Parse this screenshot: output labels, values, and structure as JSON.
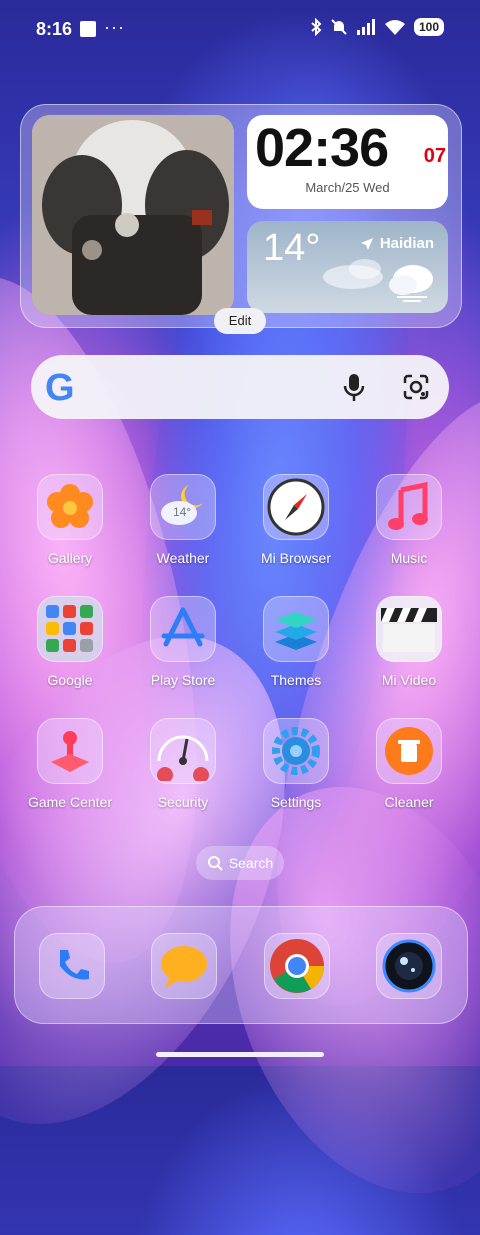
{
  "status_bar": {
    "time": "8:16",
    "dots": "···",
    "battery": "100"
  },
  "widget": {
    "clock_time": "02:36",
    "clock_seconds": "07",
    "date": "March/25 Wed",
    "weather_temp": "14°",
    "weather_location": "Haidian",
    "edit_label": "Edit"
  },
  "google_search": {
    "logo_letter": "G"
  },
  "apps": [
    {
      "label": "Gallery",
      "icon": "gallery-icon"
    },
    {
      "label": "Weather",
      "icon": "weather-icon",
      "badge": "14°"
    },
    {
      "label": "Mi Browser",
      "icon": "compass-icon"
    },
    {
      "label": "Music",
      "icon": "music-note-icon"
    },
    {
      "label": "Google",
      "icon": "google-folder-icon"
    },
    {
      "label": "Play Store",
      "icon": "play-store-icon"
    },
    {
      "label": "Themes",
      "icon": "themes-layers-icon"
    },
    {
      "label": "Mi Video",
      "icon": "clapperboard-icon"
    },
    {
      "label": "Game Center",
      "icon": "joystick-icon"
    },
    {
      "label": "Security",
      "icon": "gauge-icon"
    },
    {
      "label": "Settings",
      "icon": "gear-icon"
    },
    {
      "label": "Cleaner",
      "icon": "trash-icon"
    }
  ],
  "search_pill": {
    "label": "Search"
  },
  "dock": [
    {
      "icon": "phone-icon"
    },
    {
      "icon": "messages-icon"
    },
    {
      "icon": "chrome-icon"
    },
    {
      "icon": "camera-icon"
    }
  ],
  "colors": {
    "accent_red": "#e10012",
    "clock_bg": "#ffffff"
  }
}
